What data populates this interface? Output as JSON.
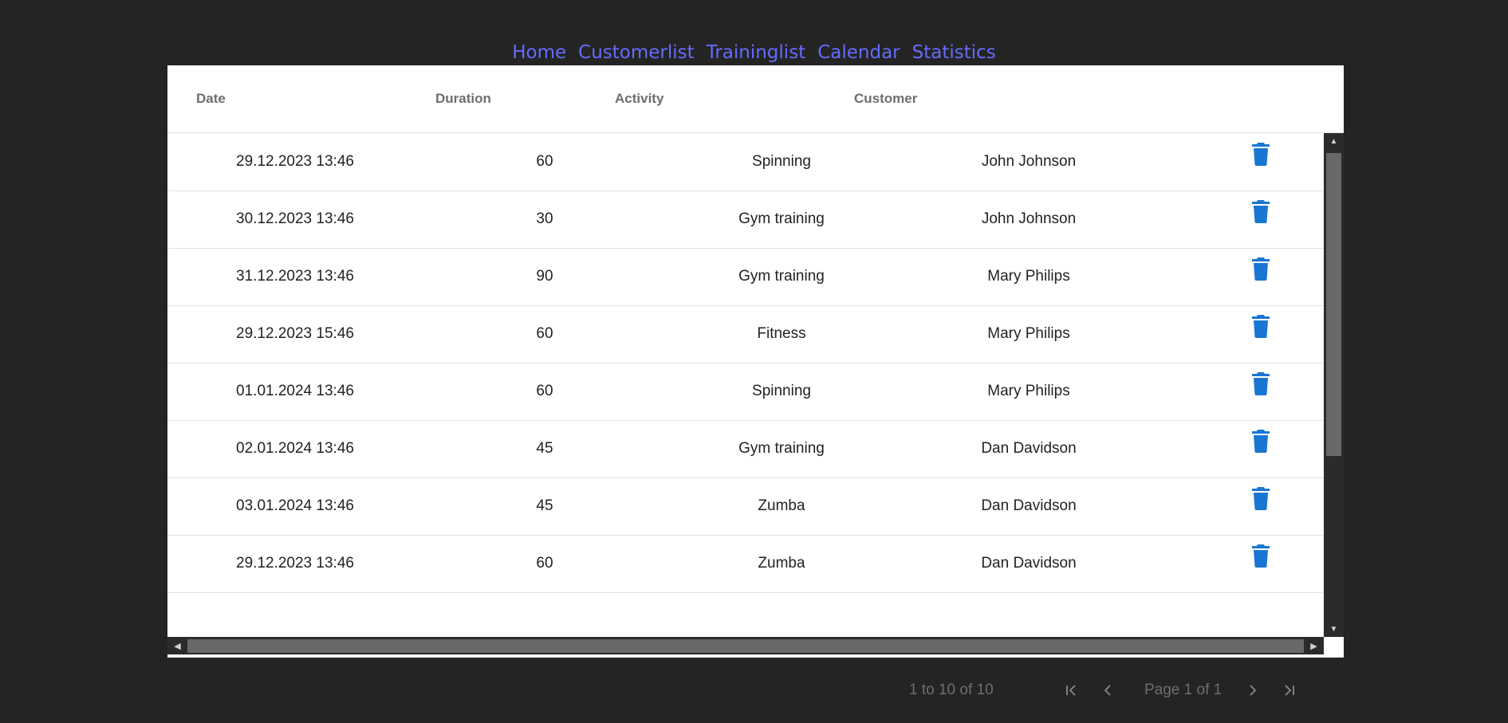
{
  "nav": {
    "links": [
      "Home",
      "Customerlist",
      "Traininglist",
      "Calendar",
      "Statistics"
    ],
    "color": "#646cff"
  },
  "grid": {
    "columns": [
      "Date",
      "Duration",
      "Activity",
      "Customer"
    ],
    "rows": [
      {
        "date": "29.12.2023 13:46",
        "duration": "60",
        "activity": "Spinning",
        "customer": "John Johnson"
      },
      {
        "date": "30.12.2023 13:46",
        "duration": "30",
        "activity": "Gym training",
        "customer": "John Johnson"
      },
      {
        "date": "31.12.2023 13:46",
        "duration": "90",
        "activity": "Gym training",
        "customer": "Mary Philips"
      },
      {
        "date": "29.12.2023 15:46",
        "duration": "60",
        "activity": "Fitness",
        "customer": "Mary Philips"
      },
      {
        "date": "01.01.2024 13:46",
        "duration": "60",
        "activity": "Spinning",
        "customer": "Mary Philips"
      },
      {
        "date": "02.01.2024 13:46",
        "duration": "45",
        "activity": "Gym training",
        "customer": "Dan Davidson"
      },
      {
        "date": "03.01.2024 13:46",
        "duration": "45",
        "activity": "Zumba",
        "customer": "Dan Davidson"
      },
      {
        "date": "29.12.2023 13:46",
        "duration": "60",
        "activity": "Zumba",
        "customer": "Dan Davidson"
      }
    ],
    "delete_icon": "trash-icon",
    "delete_icon_color": "#1976d2"
  },
  "pagination": {
    "summary": "1 to 10 of 10",
    "page_text": "Page 1 of 1",
    "first_icon": "first-page-icon",
    "prev_icon": "previous-page-icon",
    "next_icon": "next-page-icon",
    "last_icon": "last-page-icon"
  }
}
